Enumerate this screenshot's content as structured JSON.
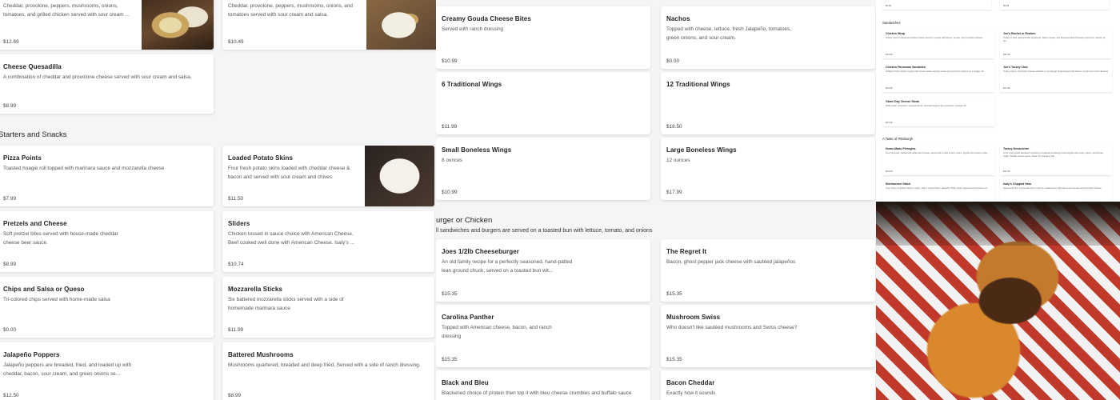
{
  "panel_left": {
    "top_cards": [
      {
        "desc": "Cheddar, provolone, peppers, mushrooms, onions, tomatoes, and grilled chicken served with sour cream ...",
        "price": "$12.69"
      },
      {
        "desc": "Cheddar, provolone, peppers, mushrooms, onions, and tomatoes served with sour cream and salsa.",
        "price": "$10.49"
      }
    ],
    "cheese_quesadilla": {
      "title": "Cheese Quesadilla",
      "desc": "A combination of cheddar and provolone cheese served with sour cream and salsa.",
      "price": "$8.99"
    },
    "section_title": "Starters and Snacks",
    "items": [
      {
        "title": "Pizza Points",
        "desc": "Toasted hoagie roll topped with marinara sauce and mozzarella cheese",
        "price": "$7.99"
      },
      {
        "title": "Loaded Potato Skins",
        "desc": "Four fresh potato skins loaded with cheddar cheese & bacon and served with sour cream and chives.",
        "price": "$11.50"
      },
      {
        "title": "Pretzels and Cheese",
        "desc": "Soft pretzel bites served with house-made cheddar cheese beer sauce.",
        "price": "$8.99"
      },
      {
        "title": "Sliders",
        "desc": "Chicken tossed in sauce choice with American Cheese. Beef cooked well done with American Cheese. Isaly's ...",
        "price": "$10.74"
      },
      {
        "title": "Chips and Salsa or Queso",
        "desc": "Tri-colored chips served with home-made salsa",
        "price": "$0.00"
      },
      {
        "title": "Mozzarella Sticks",
        "desc": "Six battered mozzarella sticks served with a side of homemade marinara sauce",
        "price": "$11.99"
      },
      {
        "title": "Jalapeño Poppers",
        "desc": "Jalapeño peppers are breaded, fried, and loaded up with cheddar, bacon, sour cream, and green onions se...",
        "price": "$12.50"
      },
      {
        "title": "Battered Mushrooms",
        "desc": "Mushrooms quartered, breaded and deep fried. Served with a side of ranch dressing.",
        "price": "$8.99"
      }
    ]
  },
  "panel_middle": {
    "items_top": [
      {
        "title": "Creamy Gouda Cheese Bites",
        "desc": "Served with ranch dressing",
        "price": "$10.99"
      },
      {
        "title": "Nachos",
        "desc": "Topped with cheese, lettuce, fresh Jalapeño, tomatoes, green onions, and sour cream.",
        "price": "$0.00"
      },
      {
        "title": "6 Traditional Wings",
        "desc": "",
        "price": "$11.99"
      },
      {
        "title": "12 Traditional Wings",
        "desc": "",
        "price": "$18.50"
      },
      {
        "title": "Small Boneless Wings",
        "desc": "8 ounces",
        "price": "$10.99"
      },
      {
        "title": "Large Boneless Wings",
        "desc": "12 ounces",
        "price": "$17.99"
      }
    ],
    "section_title": "urger or Chicken",
    "section_sub": "ll sandwiches and burgers are served on a toasted bun with lettuce, tomato, and onions",
    "items_bottom": [
      {
        "title": "Joes 1/2lb Cheeseburger",
        "desc": "An old family recipe for a perfectly seasoned, hand-patted lean ground chuck, served on a toasted bun wit...",
        "price": "$15.35"
      },
      {
        "title": "The Regret It",
        "desc": "Bacon, ghost pepper jack cheese with sautéed jalapeños",
        "price": "$15.35"
      },
      {
        "title": "Carolina Panther",
        "desc": "Topped with American cheese, bacon, and ranch dressing",
        "price": "$15.35"
      },
      {
        "title": "Mushroom Swiss",
        "desc": "Who doesn't like sautéed mushrooms and Swiss cheese?",
        "price": "$15.35"
      },
      {
        "title": "Black and Bleu",
        "desc": "Blackened choice of protein then top it with bleu cheese crumbles and buffalo sauce",
        "price": ""
      },
      {
        "title": "Bacon Cheddar",
        "desc": "Exactly how it sounds",
        "price": ""
      }
    ]
  },
  "panel_right": {
    "top_prices": [
      "$9.99",
      "$9.99"
    ],
    "sandwiches_title": "Sandwiches",
    "sandwiches": [
      {
        "title": "Chicken Wrap",
        "desc": "Grilled, fried or blackened chicken breast served in a wrap with lettuce, tomato, and provolone cheese ...",
        "price": "$15.99"
      },
      {
        "title": "Joe's Rachel or Reuben",
        "desc": "Turkey or beef pastrami with sauerkraut, Swiss cheese, and thousand island dressing served on marble rye bre...",
        "price": "$16.99"
      },
      {
        "title": "Chicken Parmesan Sandwich",
        "desc": "Grilled or fried chicken topped with house-made marinara sauce and provolone cheese on a hoagie roll",
        "price": "$14.99"
      },
      {
        "title": "Joe's Turkey Club",
        "desc": "Turkey, bacon, and Swiss cheese stacked on sourdough bread topped with lettuce, tomato and ranch dressing",
        "price": "$14.99"
      },
      {
        "title": "Game Day Cheese Steak",
        "desc": "Philly steak, provolone, sautéed onions, and bell peppers are served on a hoagie roll",
        "price": "$15.99"
      }
    ],
    "pittsburgh_title": "A Taste of Pittsburgh",
    "pittsburgh": [
      {
        "title": "Home-Made Pierogies",
        "desc": "Four pierogies, stuffed with potato and cheese, served with a side of sour cream, topped with onions, butter, ...",
        "price": "$10.00"
      },
      {
        "title": "Turkey Devonshire",
        "desc": "A hot, open-faced sandwich consisting of toasted sourdough bread topped with turkey, bacon, and house-made cheddar cheese sauce. Does not include a side.",
        "price": "$13.99"
      },
      {
        "title": "Steelworker Stack",
        "desc": "Your choice of grilled chicken, turkey, Isaly's chipped ham, jalapeño, Philly steak, topped with provolone ch...",
        "price": ""
      },
      {
        "title": "Isaly's Chipped Ham",
        "desc": "Sliced extra thin and served hot or cold on a toasted bun with lettuce and tomato and American Cheese.",
        "price": ""
      }
    ]
  }
}
